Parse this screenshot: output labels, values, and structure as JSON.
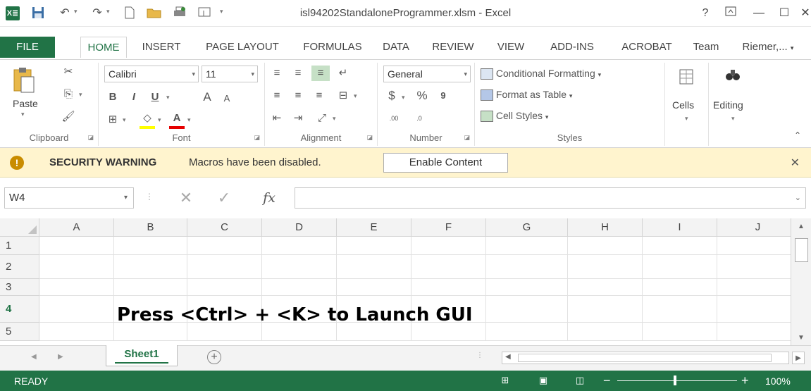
{
  "window": {
    "app_logo": "X≣",
    "doc_title": "isl94202StandaloneProgrammer.xlsm - Excel",
    "help": "?",
    "ribbon_display": "⊼",
    "minimize": "—",
    "maximize": "☐",
    "close": "✕"
  },
  "quick_access": {
    "save": "🖫",
    "undo": "↶",
    "redo": "↷",
    "new": "▢",
    "open": "📂",
    "print": "🖶",
    "touch": "☝",
    "more": "⌄"
  },
  "tabs": [
    "FILE",
    "HOME",
    "INSERT",
    "PAGE LAYOUT",
    "FORMULAS",
    "DATA",
    "REVIEW",
    "VIEW",
    "ADD-INS",
    "ACROBAT",
    "Team"
  ],
  "user": "Riemer,...",
  "ribbon": {
    "clipboard": {
      "label": "Clipboard",
      "paste": "Paste"
    },
    "font": {
      "label": "Font",
      "name": "Calibri",
      "size": "11",
      "bold": "B",
      "italic": "I",
      "underline": "U",
      "grow": "A",
      "shrink": "A",
      "font_color": "A"
    },
    "alignment": {
      "label": "Alignment"
    },
    "number": {
      "label": "Number",
      "format": "General",
      "currency": "$",
      "percent": "%",
      "comma": "9",
      "inc_decimal": ".00",
      "dec_decimal": ".0"
    },
    "styles": {
      "label": "Styles",
      "conditional": "Conditional Formatting",
      "table": "Format as Table",
      "cell_styles": "Cell Styles"
    },
    "cells": {
      "label": "Cells"
    },
    "editing": {
      "label": "Editing"
    }
  },
  "security": {
    "title": "SECURITY WARNING",
    "message": "Macros have been disabled.",
    "button": "Enable Content",
    "icon": "!"
  },
  "formula_bar": {
    "name_box": "W4",
    "fx": "fx",
    "value": ""
  },
  "grid": {
    "columns": [
      "A",
      "B",
      "C",
      "D",
      "E",
      "F",
      "G",
      "H",
      "I",
      "J"
    ],
    "rows": [
      "1",
      "2",
      "3",
      "4",
      "5"
    ],
    "active_row": "4",
    "cell_b4": "Press <Ctrl> + <K> to Launch GUI"
  },
  "sheets": {
    "active": "Sheet1",
    "add": "+"
  },
  "status": {
    "text": "READY",
    "zoom": "100%"
  }
}
